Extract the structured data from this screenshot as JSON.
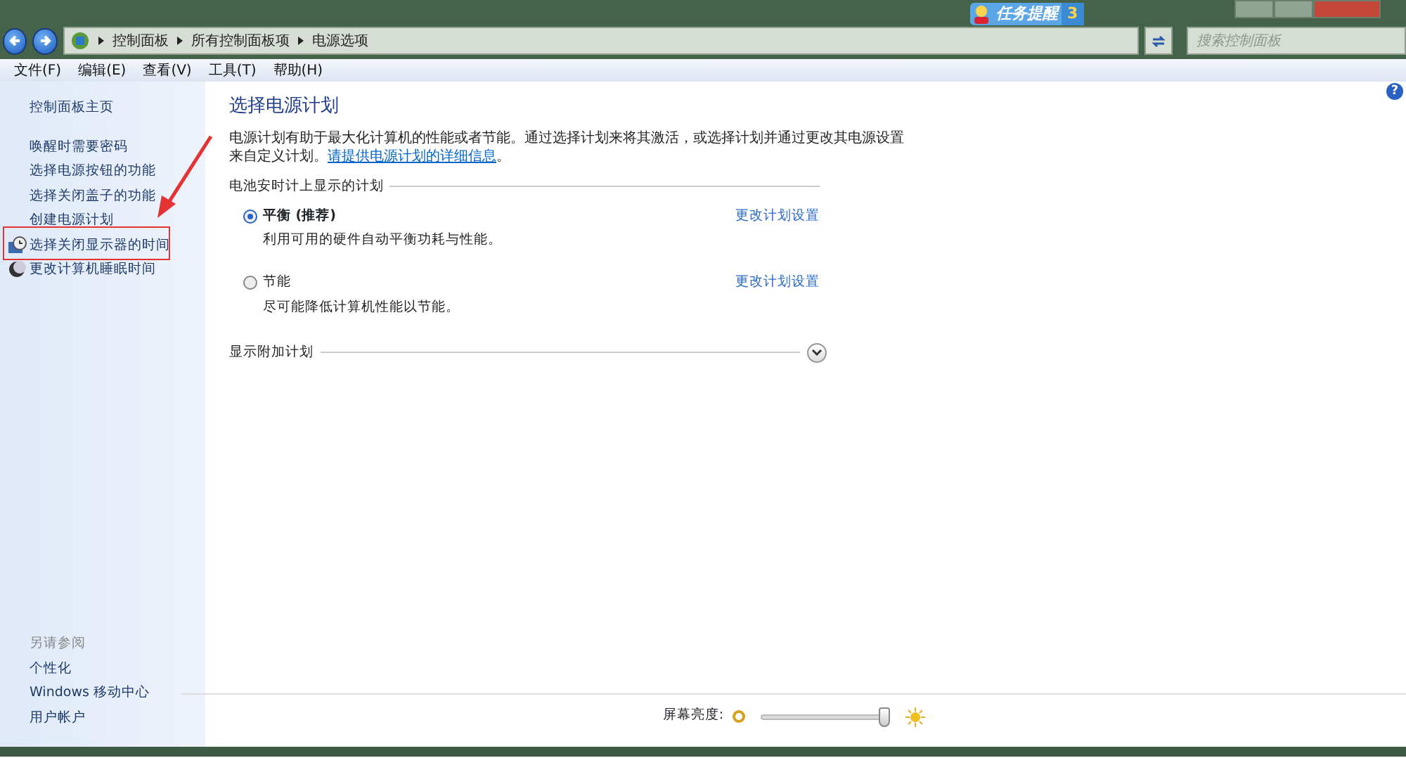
{
  "address_bar": {
    "breadcrumbs": [
      "控制面板",
      "所有控制面板项",
      "电源选项"
    ]
  },
  "notification": {
    "label": "任务提醒",
    "count": "3"
  },
  "search": {
    "placeholder": "搜索控制面板"
  },
  "menu": [
    "文件(F)",
    "编辑(E)",
    "查看(V)",
    "工具(T)",
    "帮助(H)"
  ],
  "help_button": "?",
  "sidebar": {
    "home": "控制面板主页",
    "items": [
      {
        "label": "唤醒时需要密码",
        "kind": "text"
      },
      {
        "label": "选择电源按钮的功能",
        "kind": "text"
      },
      {
        "label": "选择关闭盖子的功能",
        "kind": "text"
      },
      {
        "label": "创建电源计划",
        "kind": "text"
      },
      {
        "label": "选择关闭显示器的时间",
        "kind": "monitor"
      },
      {
        "label": "更改计算机睡眠时间",
        "kind": "sleep"
      }
    ]
  },
  "see_also": {
    "heading": "另请参阅",
    "links": [
      "个性化",
      "Windows 移动中心",
      "用户帐户"
    ]
  },
  "main": {
    "title": "选择电源计划",
    "description": "电源计划有助于最大化计算机的性能或者节能。通过选择计划来将其激活，或选择计划并通过更改其电源设置来自定义计划。",
    "link": "请提供电源计划的详细信息",
    "description_end": "。",
    "section": "电池安时计上显示的计划",
    "plans": [
      {
        "name": "平衡 (推荐)",
        "selected": true,
        "description": "利用可用的硬件自动平衡功耗与性能。",
        "action": "更改计划设置"
      },
      {
        "name": "节能",
        "selected": false,
        "description": "尽可能降低计算机性能以节能。",
        "action": "更改计划设置"
      }
    ],
    "more": "显示附加计划"
  },
  "brightness": {
    "label": "屏幕亮度:",
    "level": 0.97
  }
}
